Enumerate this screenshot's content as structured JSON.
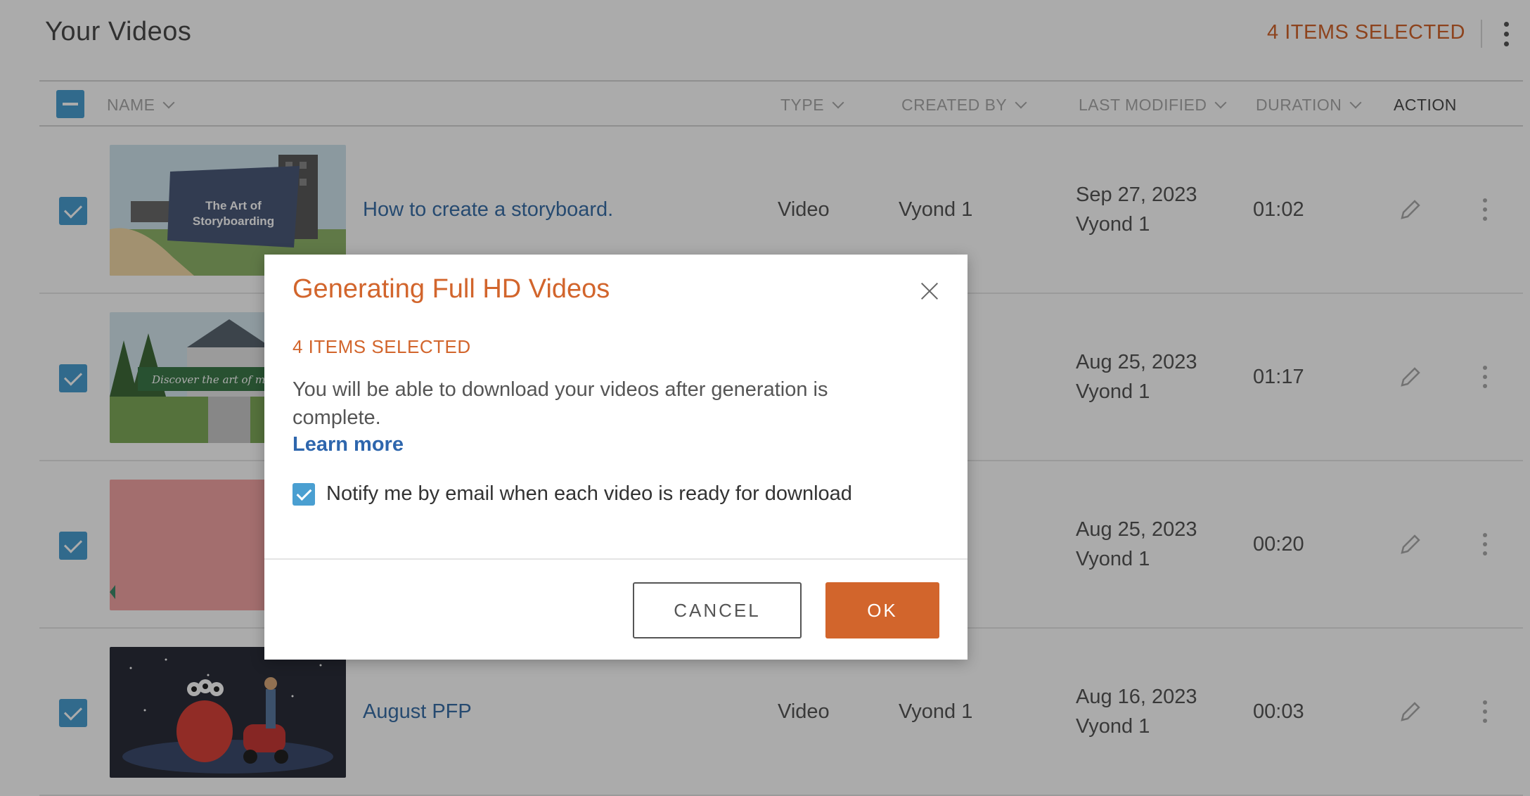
{
  "page": {
    "title": "Your Videos",
    "selected_count": "4 ITEMS SELECTED"
  },
  "table": {
    "columns": {
      "name": "NAME",
      "type": "TYPE",
      "created_by": "CREATED BY",
      "last_modified": "LAST MODIFIED",
      "duration": "DURATION",
      "action": "ACTION"
    },
    "rows": [
      {
        "name": "How to create a storyboard.",
        "type": "Video",
        "creator": "Vyond 1",
        "date": "Sep 27, 2023",
        "modified_by": "Vyond 1",
        "duration": "01:02",
        "thumb_text": "The Art of Storyboarding"
      },
      {
        "name": "",
        "type": "",
        "creator": "",
        "date": "Aug 25, 2023",
        "modified_by": "Vyond 1",
        "duration": "01:17",
        "thumb_text": "Discover the art of makin"
      },
      {
        "name": "",
        "type": "",
        "creator": "",
        "date": "Aug 25, 2023",
        "modified_by": "Vyond 1",
        "duration": "00:20"
      },
      {
        "name": "August PFP",
        "type": "Video",
        "creator": "Vyond 1",
        "date": "Aug 16, 2023",
        "modified_by": "Vyond 1",
        "duration": "00:03"
      }
    ]
  },
  "modal": {
    "title": "Generating Full HD Videos",
    "count": "4 ITEMS SELECTED",
    "body": "You will be able to download your videos after generation is complete.",
    "learn_more": "Learn more",
    "notify_label": "Notify me by email when each video is ready for download",
    "notify_checked": true,
    "cancel_label": "CANCEL",
    "ok_label": "OK"
  },
  "colors": {
    "accent": "#d2652c",
    "checkbox": "#4a9fd1",
    "link": "#2e66ad"
  }
}
